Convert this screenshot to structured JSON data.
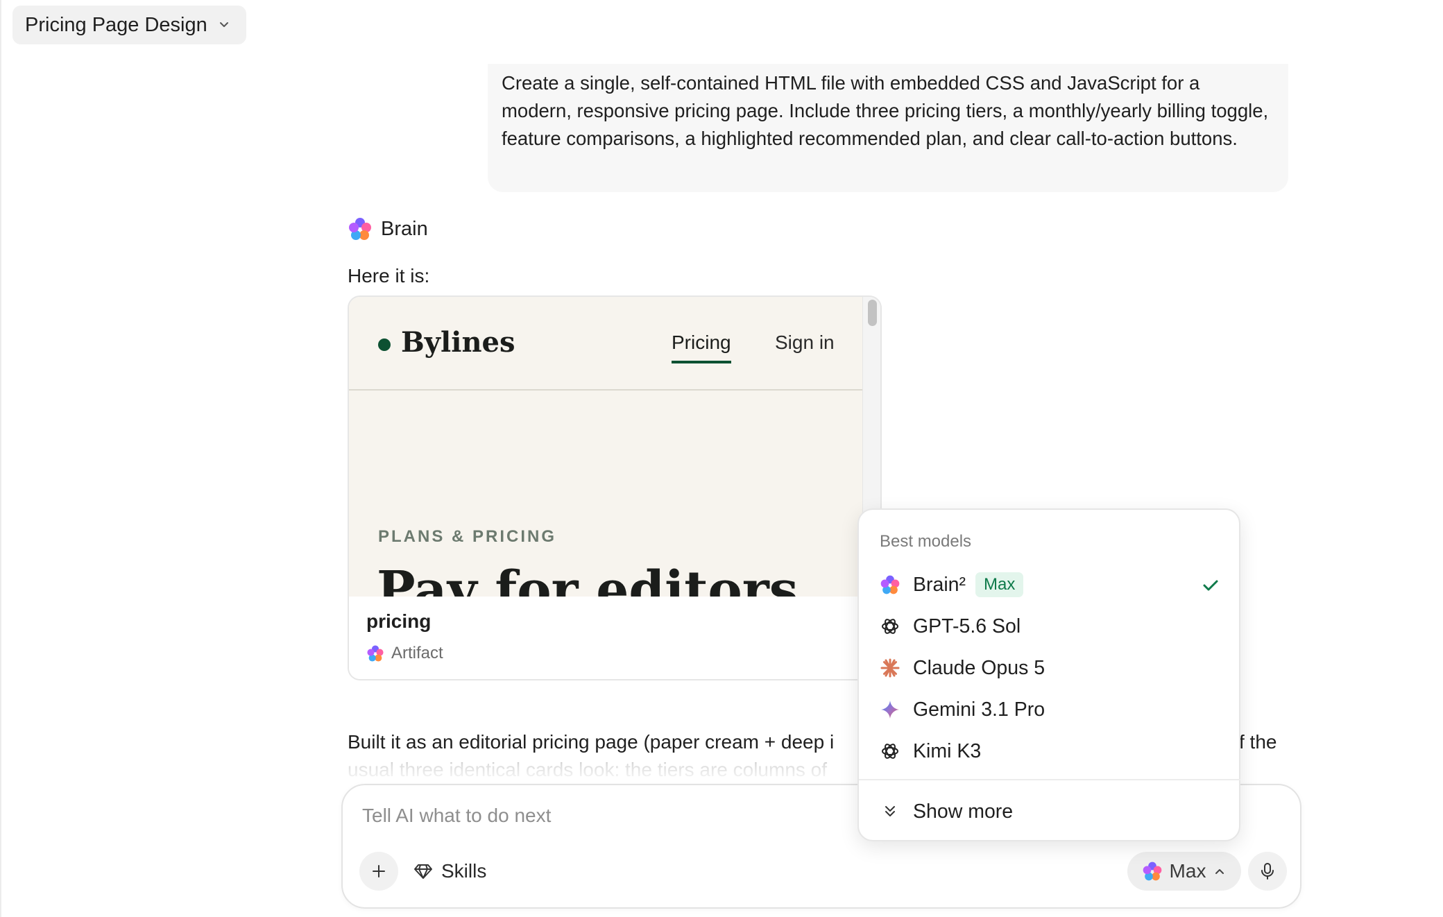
{
  "header": {
    "title": "Pricing Page Design"
  },
  "conversation": {
    "user_prompt": "Create a single, self-contained HTML file with embedded CSS and JavaScript for a modern, responsive pricing page. Include three pricing tiers, a monthly/yearly billing toggle, feature comparisons, a highlighted recommended plan, and clear call-to-action buttons.",
    "assistant_name": "Brain",
    "assistant_intro": "Here it is:",
    "body_visible": "Built it as an editorial pricing page (paper cream + deep i",
    "body_visible_end": "f the",
    "body_faded": "usual three identical cards look: the tiers are columns of"
  },
  "artifact": {
    "name": "pricing",
    "type_label": "Artifact",
    "preview": {
      "brand": "Bylines",
      "nav": [
        "Pricing",
        "Sign in"
      ],
      "eyebrow": "PLANS & PRICING",
      "headline": "Pay for editors"
    }
  },
  "composer": {
    "placeholder": "Tell AI what to do next",
    "skills_label": "Skills",
    "model_label": "Max"
  },
  "model_menu": {
    "section_label": "Best models",
    "items": [
      {
        "name": "Brain²",
        "badge": "Max",
        "icon": "brain-logo-icon",
        "selected": true
      },
      {
        "name": "GPT-5.6 Sol",
        "icon": "openai-logo-icon",
        "selected": false
      },
      {
        "name": "Claude Opus 5",
        "icon": "claude-logo-icon",
        "selected": false
      },
      {
        "name": "Gemini 3.1 Pro",
        "icon": "gemini-logo-icon",
        "selected": false
      },
      {
        "name": "Kimi K3",
        "icon": "openai-logo-icon",
        "selected": false
      }
    ],
    "show_more_label": "Show more"
  },
  "colors": {
    "accent_green": "#0d5132",
    "badge_bg": "#e3f5ec",
    "badge_text": "#0e7a4a",
    "paper": "#f7f4ee"
  }
}
